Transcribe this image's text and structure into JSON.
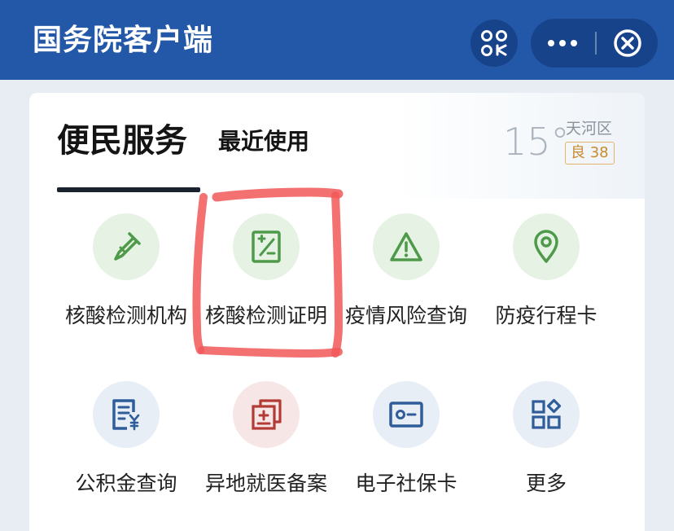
{
  "header": {
    "title": "国务院客户端",
    "scan_icon": "scan-code-icon",
    "more_icon": "more-dots-icon",
    "close_icon": "close-circle-icon"
  },
  "tabs": {
    "active": "便民服务",
    "recent": "最近使用"
  },
  "weather": {
    "temperature": "15°",
    "district": "天河区",
    "aqi": "良 38"
  },
  "services": [
    {
      "label": "核酸检测机构",
      "icon": "test-tube-icon"
    },
    {
      "label": "核酸检测证明",
      "icon": "certificate-icon"
    },
    {
      "label": "疫情风险查询",
      "icon": "warning-icon"
    },
    {
      "label": "防疫行程卡",
      "icon": "location-pin-icon"
    },
    {
      "label": "公积金查询",
      "icon": "fund-document-icon"
    },
    {
      "label": "异地就医备案",
      "icon": "medical-record-icon"
    },
    {
      "label": "电子社保卡",
      "icon": "social-card-icon"
    },
    {
      "label": "更多",
      "icon": "more-grid-icon"
    }
  ],
  "colors": {
    "header_bg": "#2357a8",
    "icon_green": "#4f9a4a",
    "icon_blue": "#2f5d99",
    "icon_red": "#b33a35",
    "annotation": "#f25858"
  }
}
